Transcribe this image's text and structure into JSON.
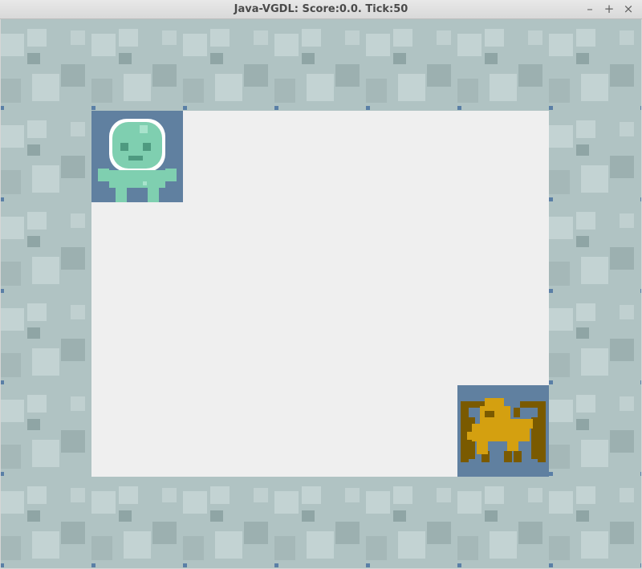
{
  "window": {
    "title": "Java-VGDL: Score:0.0. Tick:50",
    "buttons": {
      "minimize": "–",
      "maximize": "+",
      "close": "×"
    }
  },
  "game": {
    "score": 0.0,
    "tick": 50,
    "grid": {
      "cols": 7,
      "rows": 6
    },
    "map": [
      "wwwwwww",
      "wA....w",
      "w.....w",
      "w.....w",
      "w....Mw",
      "wwwwwww"
    ],
    "legend": {
      "w": "wall",
      ".": "floor",
      "A": "avatar",
      "M": "monkey"
    },
    "colors": {
      "wall": "#b0c3c3",
      "floor": "#efefef",
      "sprite_background": "#6080a0",
      "avatar": "#7fcfb0",
      "monkey": "#d4a010",
      "cage": "#7a5a00"
    }
  }
}
